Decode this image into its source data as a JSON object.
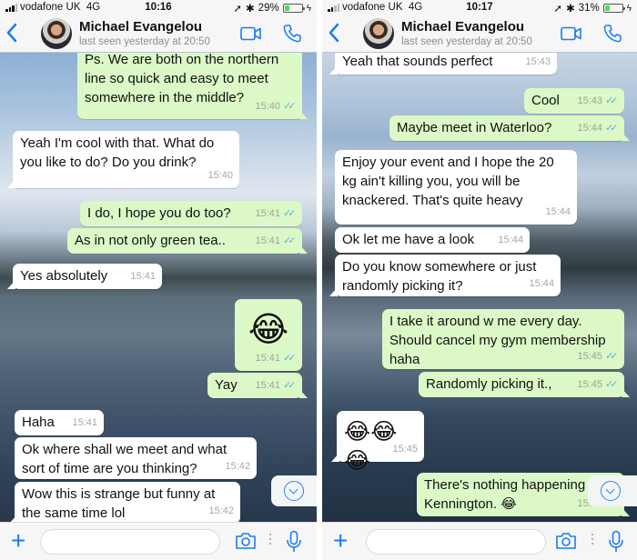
{
  "screens": [
    {
      "status": {
        "carrier": "vodafone UK",
        "network": "4G",
        "time": "10:16",
        "battery": "29%",
        "battery_level": 0.29
      },
      "header": {
        "contact_name": "Michael Evangelou",
        "last_seen": "last seen yesterday at 20:50"
      },
      "messages": [
        {
          "dir": "out",
          "text": "Ps. We are both on the northern\nline so quick and easy to meet\nsomewhere in the middle?",
          "time": "15:40",
          "read": true
        },
        {
          "dir": "in",
          "text": "Yeah I'm cool with that. What do\nyou like to do? Do you drink?",
          "time": "15:40"
        },
        {
          "dir": "out",
          "text": "I do, I hope you do too?",
          "time": "15:41",
          "read": true
        },
        {
          "dir": "out",
          "text": "As in not only green tea..",
          "time": "15:41",
          "read": true
        },
        {
          "dir": "in",
          "text": "Yes absolutely",
          "time": "15:41"
        },
        {
          "dir": "out",
          "text": "😂",
          "time": "15:41",
          "read": true
        },
        {
          "dir": "out",
          "text": "Yay",
          "time": "15:41",
          "read": true
        },
        {
          "dir": "in",
          "text": "Haha",
          "time": "15:41"
        },
        {
          "dir": "in",
          "text": "Ok where shall we meet and what\nsort of time are you thinking?",
          "time": "15:42"
        },
        {
          "dir": "in",
          "text": "Wow this is strange but funny at\nthe same time lol",
          "time": "15:42"
        }
      ]
    },
    {
      "status": {
        "carrier": "vodafone UK",
        "network": "4G",
        "time": "10:17",
        "battery": "31%",
        "battery_level": 0.31
      },
      "header": {
        "contact_name": "Michael Evangelou",
        "last_seen": "last seen yesterday at 20:50"
      },
      "messages": [
        {
          "dir": "in",
          "text": "Yeah that sounds perfect",
          "time": "15:43"
        },
        {
          "dir": "out",
          "text": "Cool",
          "time": "15:43",
          "read": true
        },
        {
          "dir": "out",
          "text": "Maybe meet in Waterloo?",
          "time": "15:44",
          "read": true
        },
        {
          "dir": "in",
          "text": "Enjoy your event and I hope the 20\nkg ain't killing you, you will be\nknackered. That's quite heavy",
          "time": "15:44"
        },
        {
          "dir": "in",
          "text": "Ok let me have a look",
          "time": "15:44"
        },
        {
          "dir": "in",
          "text": "Do you know somewhere or just\nrandomly picking it?",
          "time": "15:44"
        },
        {
          "dir": "out",
          "text": "I take it around w me every day.\nShould cancel my gym membership\nhaha",
          "time": "15:45",
          "read": true
        },
        {
          "dir": "out",
          "text": "Randomly picking it.,",
          "time": "15:45",
          "read": true
        },
        {
          "dir": "in",
          "text": "😂😂😂",
          "time": "15:45"
        },
        {
          "dir": "out",
          "text": "There's nothing happening in\nKennington. 😂",
          "time": "15:45",
          "read": true
        }
      ]
    }
  ],
  "icons": {
    "back": "‹",
    "read_ticks": "✓✓",
    "plus": "+"
  },
  "input": {
    "placeholder": ""
  },
  "colors": {
    "accent": "#1a7cf0",
    "outgoing_bubble": "#dcf8c6",
    "incoming_bubble": "#ffffff",
    "read_ticks": "#4fb6ec",
    "battery": "#4cd964"
  }
}
